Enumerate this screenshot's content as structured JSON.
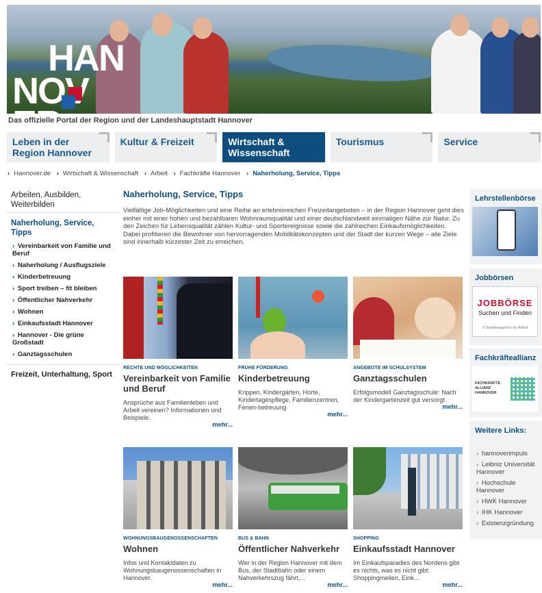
{
  "banner": {
    "logo_text": "HAN\nNOV\nER"
  },
  "tagline": "Das offizielle Portal der Region und der Landeshauptstadt Hannover",
  "mainnav": [
    {
      "label": "Leben in der Region Hannover"
    },
    {
      "label": "Kultur & Freizeit"
    },
    {
      "label": "Wirtschaft & Wissenschaft"
    },
    {
      "label": "Tourismus"
    },
    {
      "label": "Service"
    }
  ],
  "breadcrumb": [
    "Hannover.de",
    "Wirtschaft & Wissenschaft",
    "Arbeit",
    "Fachkräfte Hannover",
    "Naherholung, Service, Tipps"
  ],
  "leftnav": {
    "top": "Arbeiten, Ausbilden, Weiterbilden",
    "current": "Naherholung, Service, Tipps",
    "items": [
      "Vereinbarkeit von Familie und Beruf",
      "Naherholung / Ausflugsziele",
      "Kinderbetreuung",
      "Sport treiben – fit bleiben",
      "Öffentlicher Nahverkehr",
      "Wohnen",
      "Einkaufsstadt Hannover",
      "Hannover - Die grüne Großstadt",
      "Ganztagsschulen"
    ],
    "bottom": "Freizeit, Unterhaltung, Sport"
  },
  "content": {
    "title": "Naherholung, Service, Tipps",
    "intro": "Vielfältige Job-Möglichkeiten und eine Reihe an erlebnisreichen Freizeitangeboten – in der Region Hannover geht dies einher mit einer hohen und bezahlbaren Wohnraumqualität und einer deutschlandweit einmaligen Nähe zur Natur. Zu den Zeichen für Lebensqualität zählen Kultur- und Sportereignisse sowie die zahlreichen Einkaufsmöglichkeiten. Dabei profitieren die Bewohner von hervorragenden Mobilitätskonzepten und der Stadt der kurzen Wege – alle Ziele sind innerhalb kürzester Zeit zu erreichen."
  },
  "cards": [
    {
      "cat": "RECHTE UND MÖGLICHKEITEN",
      "title": "Vereinbarkeit von Familie und Beruf",
      "desc": "Ansprüche aus Familienleben und Arbeit vereinen? Informationen und Beispiele.",
      "more": "mehr..."
    },
    {
      "cat": "FRÜHE FÖRDERUNG",
      "title": "Kinderbetreuung",
      "desc": "Krippen, Kindergärten, Horte, Kindertagespflege, Familienzentren, Ferien-betreuung",
      "more": "mehr..."
    },
    {
      "cat": "ANGEBOTE IM SCHULSYSTEM",
      "title": "Ganztagsschulen",
      "desc": "Erfolgsmodell Ganztagsschule: Nach der Kindergartenzeit gut versorgt.",
      "more": "mehr..."
    },
    {
      "cat": "WOHNUNGSBAUGENOSSENSCHAFTEN",
      "title": "Wohnen",
      "desc": "Infos und Kontaktdaten zu Wohnungsbaugenossenschaften in Hannover.",
      "more": "mehr..."
    },
    {
      "cat": "BUS & BAHN",
      "title": "Öffentlicher Nahverkehr",
      "desc": "Wer in der Region Hannover mit dem Bus, der Stadtbahn oder einem Nahverkehrszug fährt,...",
      "more": "mehr..."
    },
    {
      "cat": "SHOPPING",
      "title": "Einkaufsstadt Hannover",
      "desc": "Im Einkaufsparadies des Nordens gibt es nichts, was es nicht gibt: Shoppingmeilen, Eink...",
      "more": "mehr..."
    }
  ],
  "rightcol": {
    "lehrstellen": "Lehrstellenbörse",
    "jobboersen": "Jobbörsen",
    "jobboerse_logo": "JOBBÖRSE",
    "jobboerse_sub": "Suchen und Finden",
    "jobboerse_credit": "© Bundesagentur für Arbeit",
    "fachkraefte": "Fachkräfteallianz",
    "fk_logo": "FACHKRÄFTE ALLIANZ HANNOVER",
    "weitere": "Weitere Links:",
    "links": [
      "hannoverimpuls",
      "Leibniz Universität Hannover",
      "Hochschule Hannover",
      "HWK Hannover",
      "IHK Hannover",
      "Existenzgründung"
    ]
  }
}
